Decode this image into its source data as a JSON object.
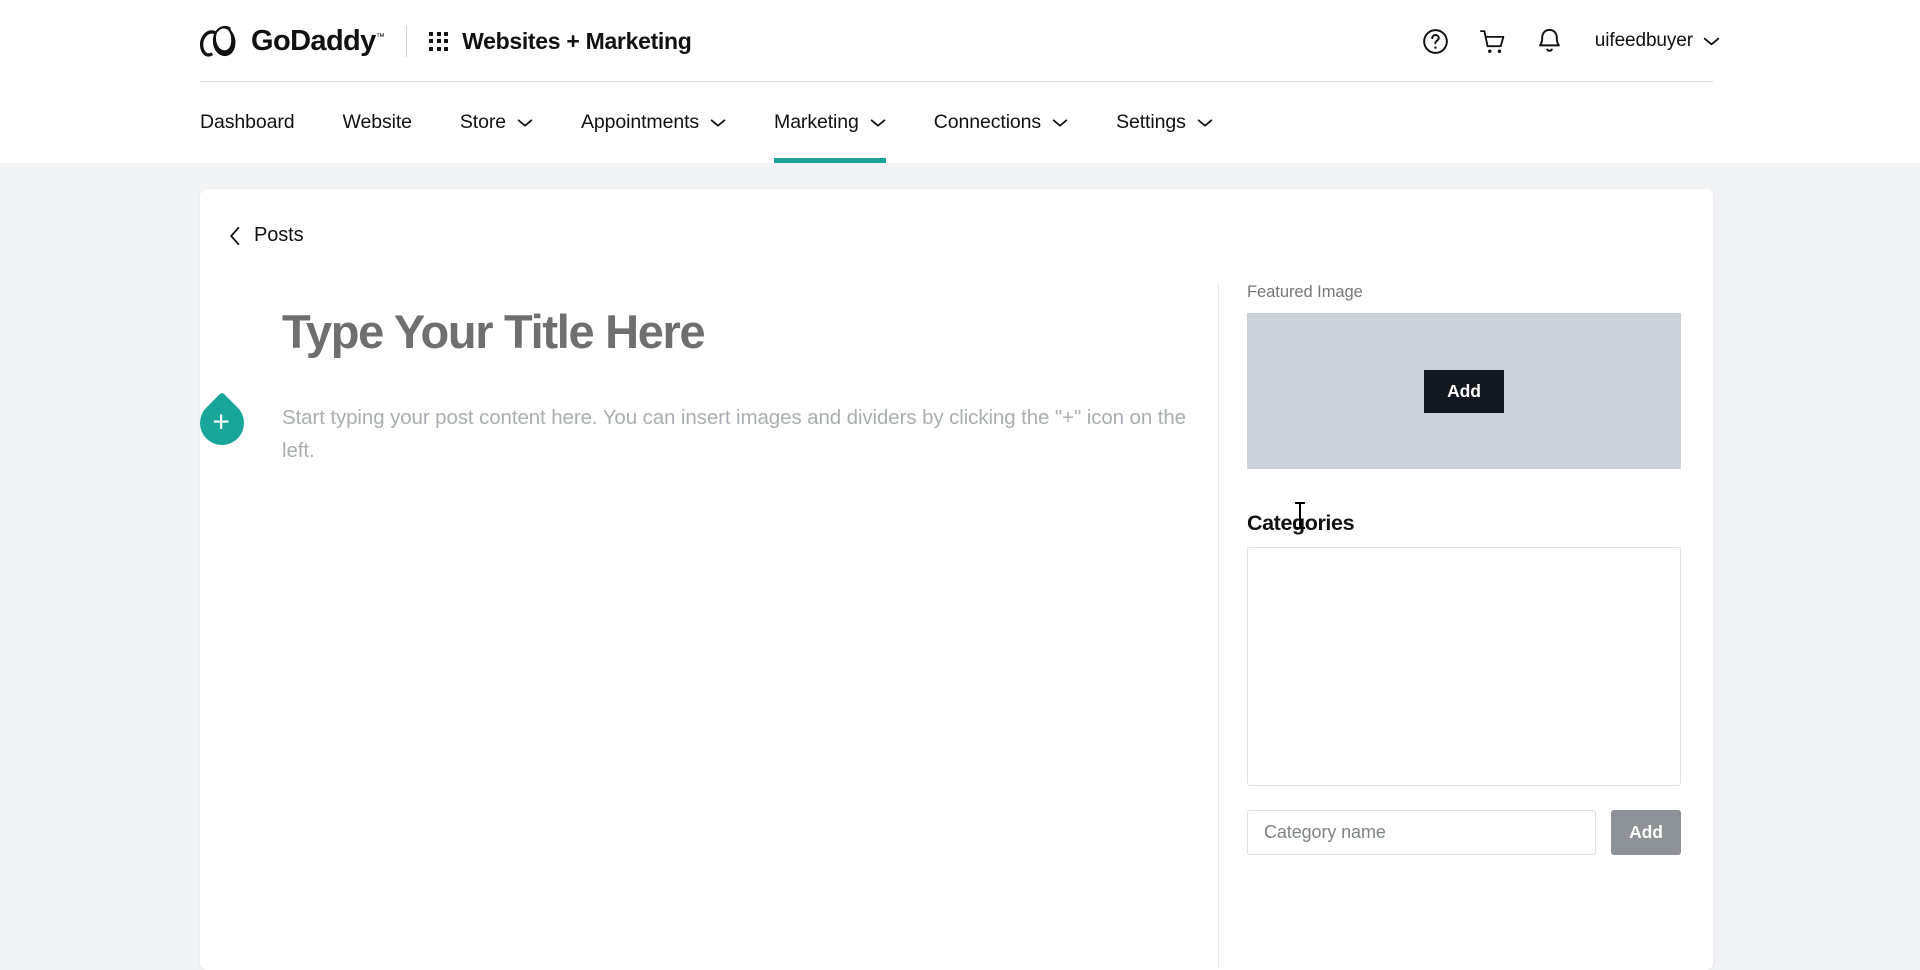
{
  "header": {
    "brand_name": "GoDaddy",
    "brand_tm": "™",
    "app_name": "Websites + Marketing",
    "waffle_icon": "app-grid-icon",
    "help_icon": "help-circle-icon",
    "cart_icon": "shopping-cart-icon",
    "bell_icon": "notification-bell-icon",
    "account_name": "uifeedbuyer",
    "account_chevron_icon": "chevron-down-icon"
  },
  "nav": {
    "items": [
      {
        "label": "Dashboard",
        "has_caret": false,
        "active": false
      },
      {
        "label": "Website",
        "has_caret": false,
        "active": false
      },
      {
        "label": "Store",
        "has_caret": true,
        "active": false
      },
      {
        "label": "Appointments",
        "has_caret": true,
        "active": false
      },
      {
        "label": "Marketing",
        "has_caret": true,
        "active": true
      },
      {
        "label": "Connections",
        "has_caret": true,
        "active": false
      },
      {
        "label": "Settings",
        "has_caret": true,
        "active": false
      }
    ],
    "active_color": "#1ba39c"
  },
  "page": {
    "back_icon": "chevron-left-icon",
    "back_label": "Posts"
  },
  "editor": {
    "title_placeholder": "Type Your Title Here",
    "body_placeholder": "Start typing your post content here. You can insert images and dividers by clicking the \"+\" icon on the left.",
    "insert_block_icon": "plus-icon",
    "insert_block_color": "#17a699"
  },
  "sidebar": {
    "featured_image": {
      "label": "Featured Image",
      "add_label": "Add",
      "placeholder_color": "#ccd2da"
    },
    "categories": {
      "heading": "Categories",
      "list_items": [],
      "input_placeholder": "Category name",
      "input_value": "",
      "add_label": "Add",
      "add_button_color": "#8d9299"
    }
  }
}
